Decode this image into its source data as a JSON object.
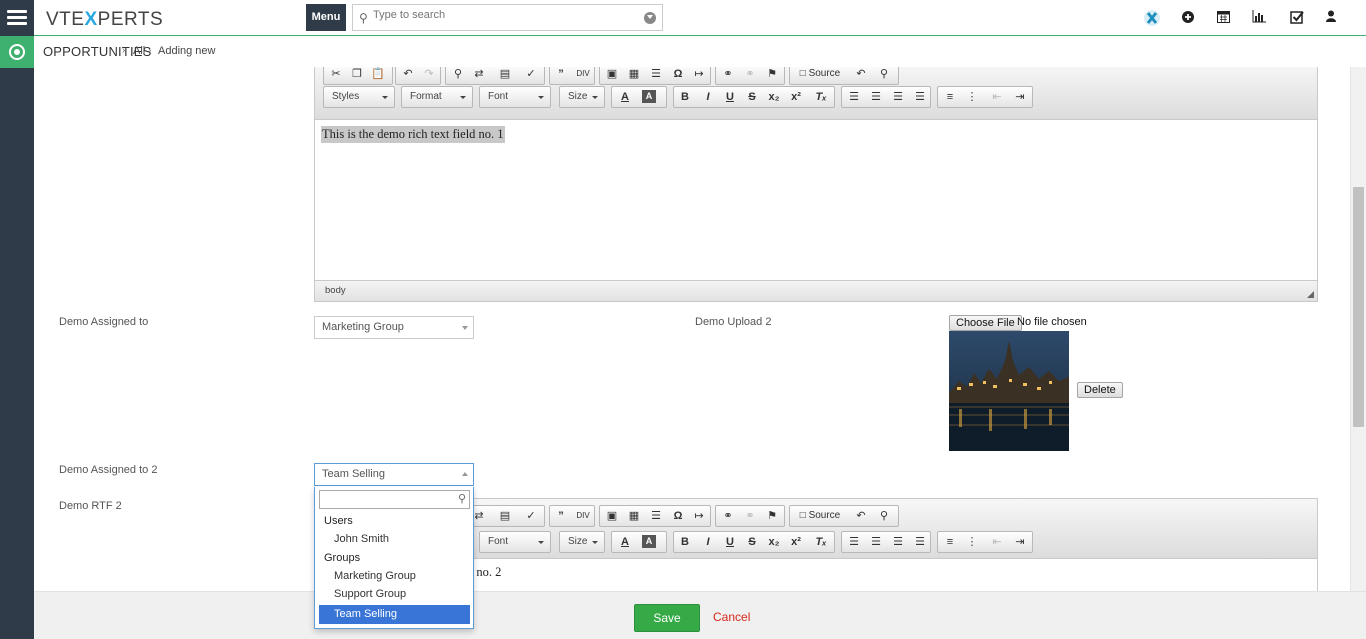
{
  "brand": {
    "prefix": "VTE",
    "x": "X",
    "suffix": "PERTS"
  },
  "topbar": {
    "menu_label": "Menu",
    "search_placeholder": "Type to search",
    "icons": [
      "vtiger-x-icon",
      "plus-circle-icon",
      "calendar-icon",
      "chart-icon",
      "checkbox-icon",
      "user-icon"
    ]
  },
  "breadcrumb": {
    "module": "OPPORTUNITIES",
    "items": [
      "All",
      "Adding new"
    ]
  },
  "editor1": {
    "text": "This is the demo rich text field no. 1",
    "status_path": "body",
    "source_label": "Source",
    "combos": {
      "styles": "Styles",
      "format": "Format",
      "font": "Font",
      "size": "Size"
    }
  },
  "fields": {
    "assigned_to": {
      "label": "Demo Assigned to",
      "value": "Marketing Group"
    },
    "upload2": {
      "label": "Demo Upload 2",
      "button": "Choose File",
      "status": "No file chosen",
      "delete_label": "Delete"
    },
    "assigned_to_2": {
      "label": "Demo Assigned to 2",
      "value": "Team Selling"
    },
    "rtf2": {
      "label": "Demo RTF 2",
      "text_visible": "d no. 2"
    }
  },
  "editor2": {
    "source_label": "Source",
    "combos": {
      "font": "Font",
      "size": "Size"
    }
  },
  "dropdown": {
    "search_value": "",
    "groups": [
      {
        "label": "Users",
        "options": [
          "John Smith"
        ]
      },
      {
        "label": "Groups",
        "options": [
          "Marketing Group",
          "Support Group",
          "Team Selling"
        ]
      }
    ],
    "highlighted": "Team Selling"
  },
  "footer": {
    "save_label": "Save",
    "cancel_label": "Cancel"
  },
  "colors": {
    "accent_green": "#3fb16e",
    "rail": "#2f3b49",
    "save": "#35aa47",
    "cancel": "#d9281d",
    "highlight": "#3875d7"
  }
}
